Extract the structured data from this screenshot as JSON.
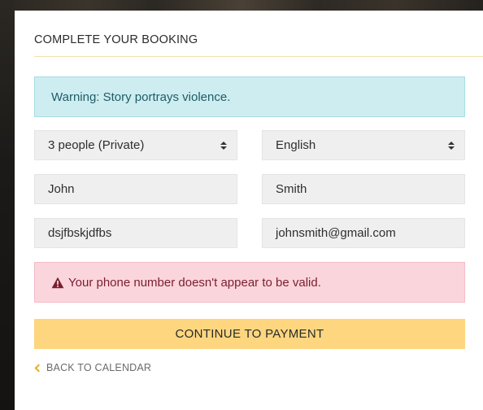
{
  "modal": {
    "title": "COMPLETE YOUR BOOKING",
    "warning_text": "Warning: Story portrays violence.",
    "party_select": {
      "selected": "3 people (Private)"
    },
    "language_select": {
      "selected": "English"
    },
    "first_name": {
      "value": "John"
    },
    "last_name": {
      "value": "Smith"
    },
    "phone": {
      "value": "dsjfbskjdfbs"
    },
    "email": {
      "value": "johnsmith@gmail.com"
    },
    "error_text": "Your phone number doesn't appear to be valid.",
    "continue_label": "CONTINUE TO PAYMENT",
    "back_label": "BACK TO CALENDAR"
  },
  "icons": {
    "select_arrows": "sort-icon",
    "error": "warning-triangle-icon",
    "back": "chevron-left-icon"
  },
  "colors": {
    "warning_bg": "#cdedf1",
    "error_bg": "#fbd5dc",
    "button_bg": "#fdd67f",
    "accent": "#e7ab2b"
  }
}
